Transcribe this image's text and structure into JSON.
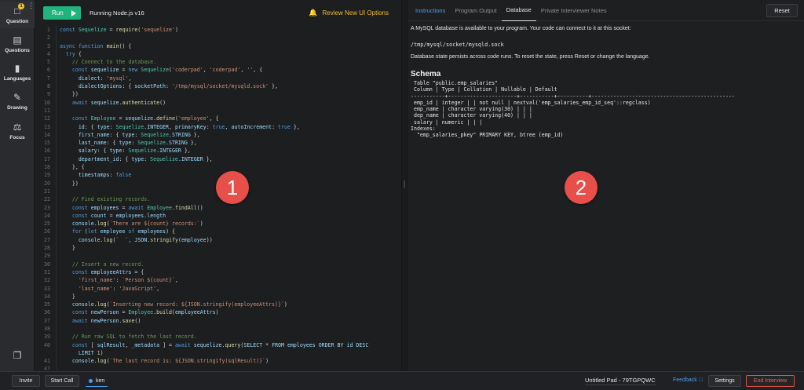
{
  "rail": {
    "question_badge": "1",
    "question_label": "Question",
    "items": [
      {
        "label": "Questions"
      },
      {
        "label": "Languages"
      },
      {
        "label": "Drawing"
      },
      {
        "label": "Focus"
      }
    ]
  },
  "editor": {
    "run_label": "Run",
    "runtime": "Running Node.js v16",
    "review_label": "Review New UI Options",
    "marker": "1"
  },
  "code_lines": [
    {
      "n": "1",
      "t": "const Sequelize = require('sequelize')"
    },
    {
      "n": "2",
      "t": ""
    },
    {
      "n": "3",
      "t": "async function main() {"
    },
    {
      "n": "4",
      "t": "  try {"
    },
    {
      "n": "5",
      "t": "    // Connect to the database."
    },
    {
      "n": "6",
      "t": "    const sequelize = new Sequelize('coderpad', 'coderpad', '', {"
    },
    {
      "n": "7",
      "t": "      dialect: 'mysql',"
    },
    {
      "n": "8",
      "t": "      dialectOptions: { socketPath: '/tmp/mysql/socket/mysqld.sock' },"
    },
    {
      "n": "9",
      "t": "    })"
    },
    {
      "n": "10",
      "t": "    await sequelize.authenticate()"
    },
    {
      "n": "11",
      "t": ""
    },
    {
      "n": "12",
      "t": "    const Employee = sequelize.define('employee', {"
    },
    {
      "n": "13",
      "t": "      id: { type: Sequelize.INTEGER, primaryKey: true, autoIncrement: true },"
    },
    {
      "n": "14",
      "t": "      first_name: { type: Sequelize.STRING },"
    },
    {
      "n": "15",
      "t": "      last_name: { type: Sequelize.STRING },"
    },
    {
      "n": "16",
      "t": "      salary: { type: Sequelize.INTEGER },"
    },
    {
      "n": "17",
      "t": "      department_id: { type: Sequelize.INTEGER },"
    },
    {
      "n": "18",
      "t": "    }, {"
    },
    {
      "n": "19",
      "t": "      timestamps: false"
    },
    {
      "n": "20",
      "t": "    })"
    },
    {
      "n": "21",
      "t": ""
    },
    {
      "n": "22",
      "t": "    // Find existing records."
    },
    {
      "n": "23",
      "t": "    const employees = await Employee.findAll()"
    },
    {
      "n": "24",
      "t": "    const count = employees.length"
    },
    {
      "n": "25",
      "t": "    console.log(`There are ${count} records:`)"
    },
    {
      "n": "26",
      "t": "    for (let employee of employees) {"
    },
    {
      "n": "27",
      "t": "      console.log(`  `, JSON.stringify(employee))"
    },
    {
      "n": "28",
      "t": "    }"
    },
    {
      "n": "29",
      "t": ""
    },
    {
      "n": "30",
      "t": "    // Insert a new record."
    },
    {
      "n": "31",
      "t": "    const employeeAttrs = {"
    },
    {
      "n": "32",
      "t": "      'first_name': `Person ${count}`,"
    },
    {
      "n": "33",
      "t": "      'last_name': 'JavaScript',"
    },
    {
      "n": "34",
      "t": "    }"
    },
    {
      "n": "35",
      "t": "    console.log(`Inserting new record: ${JSON.stringify(employeeAttrs)}`)"
    },
    {
      "n": "36",
      "t": "    const newPerson = Employee.build(employeeAttrs)"
    },
    {
      "n": "37",
      "t": "    await newPerson.save()"
    },
    {
      "n": "38",
      "t": ""
    },
    {
      "n": "39",
      "t": "    // Run raw SQL to fetch the last record."
    },
    {
      "n": "40",
      "t": "    const [ sqlResult, _metadata ] = await sequelize.query('SELECT * FROM employees ORDER BY id DESC"
    },
    {
      "n": "",
      "t": "      LIMIT 1')"
    },
    {
      "n": "41",
      "t": "    console.log(`The last record is: ${JSON.stringify(sqlResult)}`)"
    },
    {
      "n": "42",
      "t": ""
    }
  ],
  "pane": {
    "tabs": [
      {
        "label": "Instructions"
      },
      {
        "label": "Program Output"
      },
      {
        "label": "Database"
      },
      {
        "label": "Private Interviewer Notes"
      }
    ],
    "reset_label": "Reset",
    "intro": "A MySQL database is available to your program. Your code can connect to it at this socket:",
    "socket": "/tmp/mysql/socket/mysqld.sock",
    "persist": "Database state persists across code runs. To reset the state, press Reset or change the language.",
    "schema_heading": "Schema",
    "schema_text": " Table \"public.emp_salaries\"\n Column | Type | Collation | Nullable | Default\n-----------+----------------------+-----------+----------+----------------------------------------------\n emp_id | integer | | not null | nextval('emp_salaries_emp_id_seq'::regclass)\n emp_name | character varying(30) | | |\n dep_name | character varying(40) | | |\n salary | numeric | | |\nIndexes:\n  \"emp_salaries_pkey\" PRIMARY KEY, btree (emp_id)",
    "marker": "2"
  },
  "bottom": {
    "invite_label": "Invite",
    "start_call_label": "Start Call",
    "user_name": "ken",
    "pad_name": "Untitled Pad - 79TGPQWC",
    "feedback_label": "Feedback",
    "settings_label": "Settings",
    "end_label": "End Interview"
  }
}
